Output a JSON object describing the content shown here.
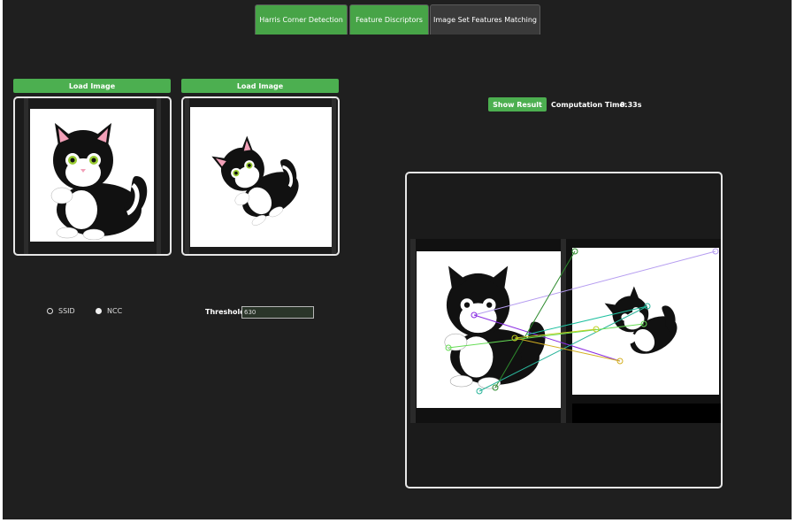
{
  "tabs": [
    {
      "label": "Harris Corner Detection",
      "active": false
    },
    {
      "label": "Feature Discriptors",
      "active": false
    },
    {
      "label": "Image Set Features Matching",
      "active": true
    }
  ],
  "left_panel": {
    "load_image_1": "Load Image",
    "load_image_2": "Load Image"
  },
  "methods": {
    "ssid_label": "SSID",
    "ncc_label": "NCC",
    "selected": "NCC"
  },
  "threshold": {
    "label": "Threshold",
    "value": "630"
  },
  "result": {
    "show_result_label": "Show Result",
    "computation_time_label": "Computation Time:",
    "computation_time_value": "0.33s"
  },
  "colors": {
    "accent_green": "#4caf50",
    "background": "#1f1f1f",
    "panel_border": "#e6e6e6"
  }
}
